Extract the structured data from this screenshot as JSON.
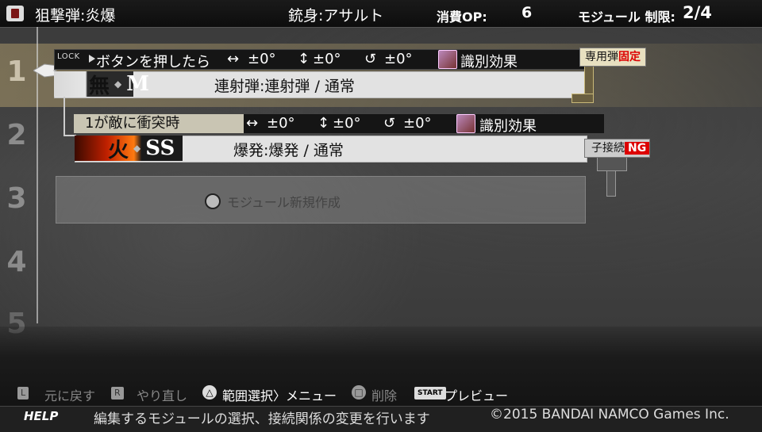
{
  "header": {
    "bullet_name": "狙撃弾:炎爆",
    "gun_label": "銃身:",
    "gun_value": "アサルト",
    "op_label": "消費OP:",
    "op_value": "6",
    "limit_label": "モジュール 制限:",
    "limit_value": "2/4"
  },
  "rows": {
    "numbers": [
      "1",
      "2",
      "3",
      "4",
      "5"
    ]
  },
  "module1": {
    "lock_label": "LOCK",
    "trigger": "ボタンを押したら",
    "h_angle": "±0°",
    "v_angle": "±0°",
    "r_angle": "±0°",
    "effect": "識別効果",
    "element": "無",
    "size": "M",
    "description": "連射弾:連射弾 / 通常",
    "tag_prefix": "専用弾",
    "tag_highlight": "固定"
  },
  "module2": {
    "trigger": "1が敵に衝突時",
    "h_angle": "±0°",
    "v_angle": "±0°",
    "r_angle": "±0°",
    "effect": "識別効果",
    "element": "火",
    "size": "SS",
    "description": "爆発:爆発 / 通常",
    "tag_prefix": "子接続",
    "tag_highlight": "NG"
  },
  "new_module": {
    "label": "モジュール新規作成"
  },
  "controls": {
    "undo_key": "L",
    "undo_label": "元に戻す",
    "redo_key": "R",
    "redo_label": "やり直し",
    "triangle_key": "△",
    "range_label": "範囲選択",
    "menu_label": "メニュー",
    "square_key": "□",
    "delete_label": "削除",
    "start_key": "START",
    "preview_label": "プレビュー"
  },
  "footer": {
    "help_label": "HELP",
    "help_text": "編集するモジュールの選択、接続関係の変更を行います",
    "copyright": "©2015 BANDAI NAMCO Games Inc."
  },
  "colors": {
    "accent_red": "#dd0000",
    "tag_bg": "#e8e0c0",
    "bar_bg": "#e2e2e2"
  }
}
